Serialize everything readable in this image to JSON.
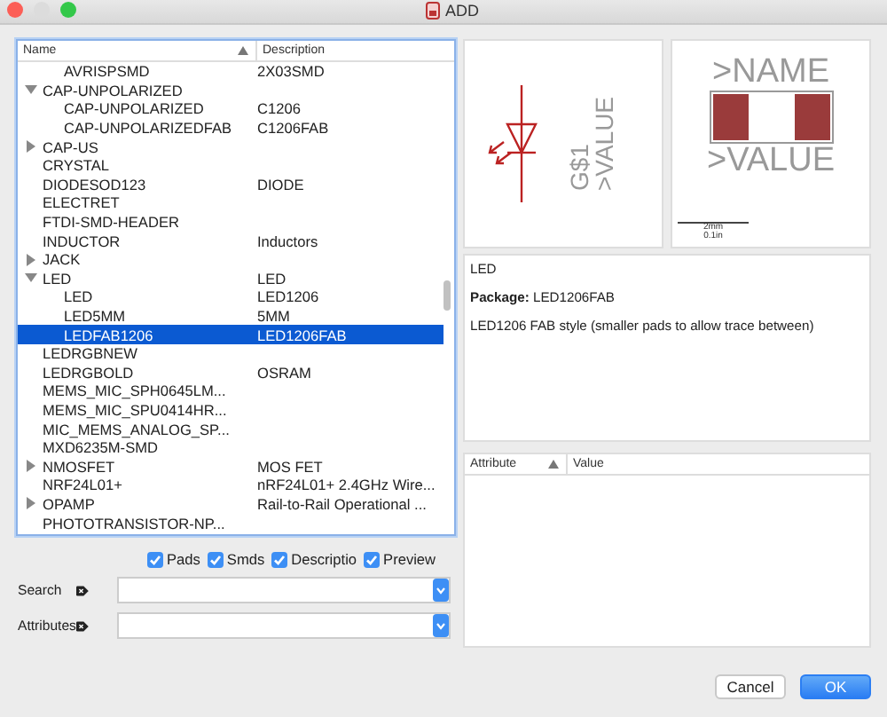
{
  "window": {
    "title": "ADD"
  },
  "tree": {
    "columns": [
      {
        "label": "Name",
        "sorted": true
      },
      {
        "label": "Description",
        "sorted": false
      }
    ],
    "items": [
      {
        "children": [
          {
            "name": "AVRISPSMD",
            "description": "2X03SMD",
            "selected": false
          }
        ]
      },
      {
        "name": "CAP-UNPOLARIZED",
        "expanded": true,
        "selected": false,
        "children": [
          {
            "name": "CAP-UNPOLARIZED",
            "description": "C1206",
            "selected": false
          },
          {
            "name": "CAP-UNPOLARIZEDFAB",
            "description": "C1206FAB",
            "selected": false
          }
        ]
      },
      {
        "name": "CAP-US",
        "expanded": false,
        "selected": false
      },
      {
        "name": "CRYSTAL",
        "selected": false
      },
      {
        "name": "DIODESOD123",
        "description": "DIODE",
        "selected": false
      },
      {
        "name": "ELECTRET",
        "selected": false
      },
      {
        "name": "FTDI-SMD-HEADER",
        "selected": false
      },
      {
        "name": "INDUCTOR",
        "description": "Inductors",
        "selected": false
      },
      {
        "name": "JACK",
        "expanded": false,
        "selected": false
      },
      {
        "name": "LED",
        "description": "LED",
        "expanded": true,
        "selected": false,
        "children": [
          {
            "name": "LED",
            "description": "LED1206",
            "selected": false
          },
          {
            "name": "LED5MM",
            "description": "5MM",
            "selected": false
          },
          {
            "name": "LEDFAB1206",
            "description": "LED1206FAB",
            "selected": true
          }
        ]
      },
      {
        "name": "LEDRGBNEW",
        "selected": false
      },
      {
        "name": "LEDRGBOLD",
        "description": "OSRAM",
        "selected": false
      },
      {
        "name": "MEMS_MIC_SPH0645LM...",
        "selected": false
      },
      {
        "name": "MEMS_MIC_SPU0414HR...",
        "selected": false
      },
      {
        "name": "MIC_MEMS_ANALOG_SP...",
        "selected": false
      },
      {
        "name": "MXD6235M-SMD",
        "selected": false
      },
      {
        "name": "NMOSFET",
        "description": "MOS FET",
        "expanded": false,
        "selected": false
      },
      {
        "name": "NRF24L01+",
        "description": "nRF24L01+ 2.4GHz Wire...",
        "selected": false
      },
      {
        "name": "OPAMP",
        "description": "Rail-to-Rail Operational ...",
        "expanded": false,
        "selected": false
      },
      {
        "name": "PHOTOTRANSISTOR-NP...",
        "selected": false
      }
    ]
  },
  "options": [
    {
      "label": "Pads",
      "checked": true
    },
    {
      "label": "Smds",
      "checked": true
    },
    {
      "label": "Descriptio",
      "checked": true
    },
    {
      "label": "Preview",
      "checked": true
    }
  ],
  "filters": [
    {
      "label": "Search"
    },
    {
      "label": "Attributes"
    }
  ],
  "symbol_preview": {
    "name_label": "G$1",
    "value_label": ">VALUE"
  },
  "package_preview": {
    "name_label": ">NAME",
    "value_label": ">VALUE",
    "scale_top": "2mm",
    "scale_bottom": "0.1in"
  },
  "description": {
    "title": "LED",
    "package": "**Package:** LED1206FAB",
    "text": "LED1206 FAB style (smaller pads to allow trace between)"
  },
  "attributes_table": {
    "columns": [
      {
        "label": "Attribute",
        "sorted": true
      },
      {
        "label": "Value",
        "sorted": false
      }
    ]
  },
  "buttons": [
    {
      "label": "Cancel",
      "kind": "secondary"
    },
    {
      "label": "OK",
      "kind": "primary"
    }
  ]
}
